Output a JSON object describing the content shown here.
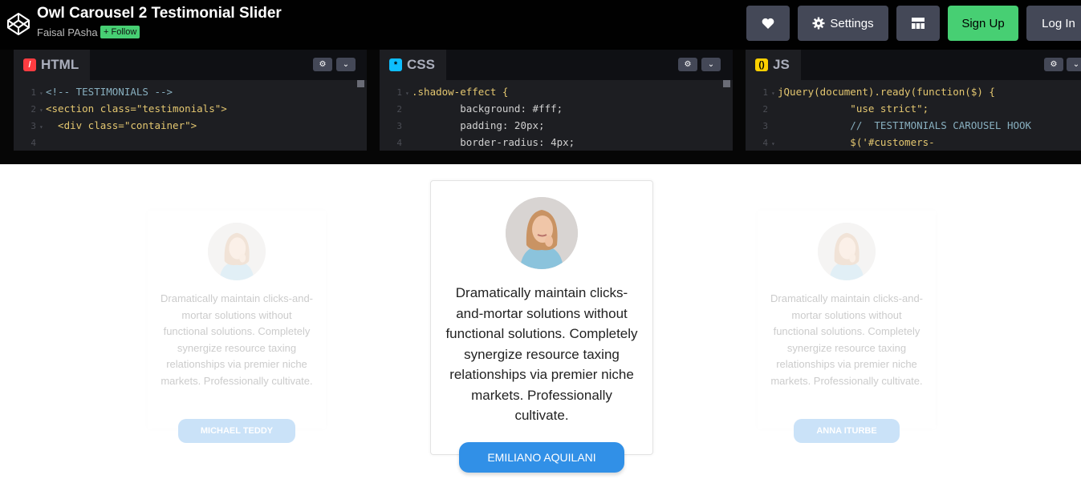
{
  "header": {
    "title": "Owl Carousel 2 Testimonial Slider",
    "author": "Faisal PAsha",
    "follow_label": "+ Follow",
    "settings_label": "Settings",
    "signup_label": "Sign Up",
    "login_label": "Log In"
  },
  "editors": {
    "html": {
      "label": "HTML",
      "lines": [
        {
          "n": "1",
          "text": "<!-- TESTIMONIALS -->"
        },
        {
          "n": "2",
          "text": "<section class=\"testimonials\">"
        },
        {
          "n": "3",
          "text": "  <div class=\"container\">"
        },
        {
          "n": "4",
          "text": ""
        }
      ]
    },
    "css": {
      "label": "CSS",
      "lines": [
        {
          "n": "1",
          "text": ".shadow-effect {"
        },
        {
          "n": "2",
          "text": "        background: #fff;"
        },
        {
          "n": "3",
          "text": "        padding: 20px;"
        },
        {
          "n": "4",
          "text": "        border-radius: 4px;"
        }
      ]
    },
    "js": {
      "label": "JS",
      "lines": [
        {
          "n": "1",
          "text": "jQuery(document).ready(function($) {"
        },
        {
          "n": "2",
          "text": "            \"use strict\";"
        },
        {
          "n": "3",
          "text": "            //  TESTIMONIALS CAROUSEL HOOK"
        },
        {
          "n": "4",
          "text": "            $('#customers-"
        }
      ]
    }
  },
  "testimonials": [
    {
      "text": "Dramatically maintain clicks-and-mortar solutions without functional solutions. Completely synergize resource taxing relationships via premier niche markets. Professionally cultivate.",
      "name": "MICHAEL TEDDY"
    },
    {
      "text": "Dramatically maintain clicks-and-mortar solutions without functional solutions. Completely synergize resource taxing relationships via premier niche markets. Professionally cultivate.",
      "name": "EMILIANO AQUILANI"
    },
    {
      "text": "Dramatically maintain clicks-and-mortar solutions without functional solutions. Completely synergize resource taxing relationships via premier niche markets. Professionally cultivate.",
      "name": "ANNA ITURBE"
    }
  ],
  "colors": {
    "accent_blue": "#3190e7",
    "codepen_green": "#47cf73"
  }
}
